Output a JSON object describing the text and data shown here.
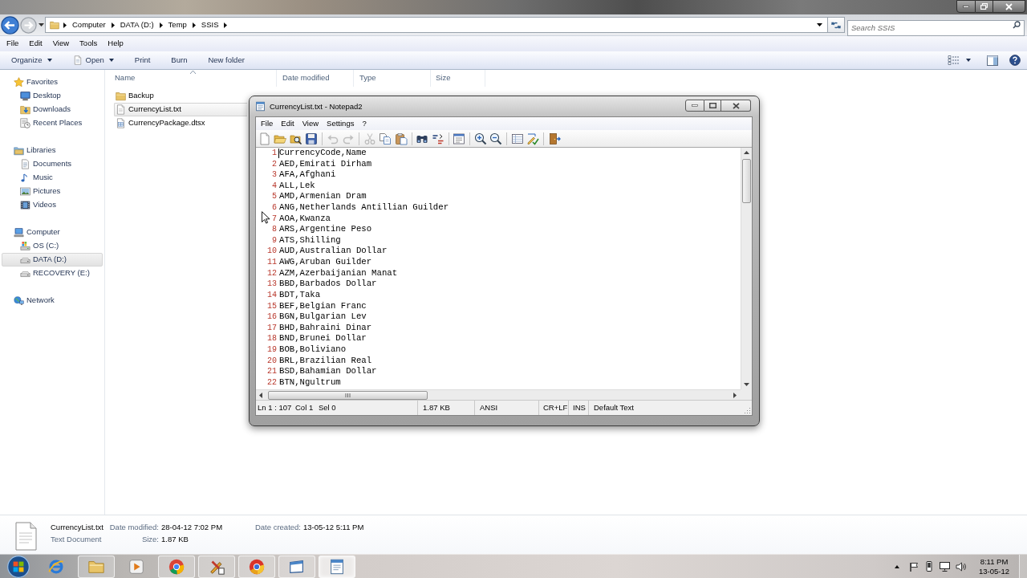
{
  "explorer": {
    "navigation": {
      "back": {
        "disabled": false
      },
      "forward": {
        "disabled": true
      }
    },
    "address_bar": {
      "path": [
        "Computer",
        "DATA (D:)",
        "Temp",
        "SSIS"
      ]
    },
    "search": {
      "placeholder": "Search SSIS"
    },
    "menu": [
      "File",
      "Edit",
      "View",
      "Tools",
      "Help"
    ],
    "commands": [
      {
        "label": "Organize",
        "dropdown": true
      },
      {
        "label": "Open",
        "dropdown": true
      },
      {
        "label": "Print",
        "dropdown": false
      },
      {
        "label": "Burn",
        "dropdown": false
      },
      {
        "label": "New folder",
        "dropdown": false
      }
    ],
    "navigation_pane": [
      {
        "label": "Favorites",
        "selected": false,
        "children": [
          {
            "label": "Desktop",
            "selected": false
          },
          {
            "label": "Downloads",
            "selected": false
          },
          {
            "label": "Recent Places",
            "selected": false
          }
        ]
      },
      {
        "label": "Libraries",
        "selected": false,
        "children": [
          {
            "label": "Documents",
            "selected": false
          },
          {
            "label": "Music",
            "selected": false
          },
          {
            "label": "Pictures",
            "selected": false
          },
          {
            "label": "Videos",
            "selected": false
          }
        ]
      },
      {
        "label": "Computer",
        "selected": false,
        "children": [
          {
            "label": "OS (C:)",
            "selected": false
          },
          {
            "label": "DATA (D:)",
            "selected": true
          },
          {
            "label": "RECOVERY (E:)",
            "selected": false
          }
        ]
      },
      {
        "label": "Network",
        "selected": false
      }
    ],
    "columns": [
      {
        "label": "Name",
        "sorted": true
      },
      {
        "label": "Date modified",
        "sorted": false
      },
      {
        "label": "Type",
        "sorted": false
      },
      {
        "label": "Size",
        "sorted": false
      }
    ],
    "files": [
      {
        "name": "Backup",
        "selected": false
      },
      {
        "name": "CurrencyList.txt",
        "selected": true
      },
      {
        "name": "CurrencyPackage.dtsx",
        "selected": false
      }
    ],
    "details": {
      "name": "CurrencyList.txt",
      "type": "Text Document",
      "properties": [
        {
          "label": "Date modified:",
          "value": "28-04-12 7:02 PM"
        },
        {
          "label": "Size:",
          "value": "1.87 KB"
        },
        {
          "label": "Date created:",
          "value": "13-05-12 5:11 PM"
        }
      ]
    }
  },
  "notepad": {
    "title": "CurrencyList.txt - Notepad2",
    "menu": [
      "File",
      "Edit",
      "View",
      "Settings",
      "?"
    ],
    "toolbar": [
      [
        {
          "disabled": false
        },
        {
          "disabled": false
        },
        {
          "disabled": false
        },
        {
          "disabled": false
        }
      ],
      [
        {
          "disabled": true
        },
        {
          "disabled": true
        }
      ],
      [
        {
          "disabled": true
        },
        {
          "disabled": false
        },
        {
          "disabled": false
        }
      ],
      [
        {
          "disabled": false
        },
        {
          "disabled": false
        }
      ],
      [
        {
          "disabled": false
        }
      ],
      [
        {
          "disabled": false
        },
        {
          "disabled": false
        }
      ],
      [
        {
          "disabled": false
        },
        {
          "disabled": false
        }
      ],
      [
        {
          "disabled": false
        }
      ]
    ],
    "lines": [
      {
        "number": "1",
        "text": "CurrencyCode,Name"
      },
      {
        "number": "2",
        "text": "AED,Emirati Dirham"
      },
      {
        "number": "3",
        "text": "AFA,Afghani"
      },
      {
        "number": "4",
        "text": "ALL,Lek"
      },
      {
        "number": "5",
        "text": "AMD,Armenian Dram"
      },
      {
        "number": "6",
        "text": "ANG,Netherlands Antillian Guilder"
      },
      {
        "number": "7",
        "text": "AOA,Kwanza"
      },
      {
        "number": "8",
        "text": "ARS,Argentine Peso"
      },
      {
        "number": "9",
        "text": "ATS,Shilling"
      },
      {
        "number": "10",
        "text": "AUD,Australian Dollar"
      },
      {
        "number": "11",
        "text": "AWG,Aruban Guilder"
      },
      {
        "number": "12",
        "text": "AZM,Azerbaijanian Manat"
      },
      {
        "number": "13",
        "text": "BBD,Barbados Dollar"
      },
      {
        "number": "14",
        "text": "BDT,Taka"
      },
      {
        "number": "15",
        "text": "BEF,Belgian Franc"
      },
      {
        "number": "16",
        "text": "BGN,Bulgarian Lev"
      },
      {
        "number": "17",
        "text": "BHD,Bahraini Dinar"
      },
      {
        "number": "18",
        "text": "BND,Brunei Dollar"
      },
      {
        "number": "19",
        "text": "BOB,Boliviano"
      },
      {
        "number": "20",
        "text": "BRL,Brazilian Real"
      },
      {
        "number": "21",
        "text": "BSD,Bahamian Dollar"
      },
      {
        "number": "22",
        "text": "BTN,Ngultrum"
      }
    ],
    "status_bar": [
      "Ln 1 : 107",
      "Col 1",
      "Sel 0",
      "1.87 KB",
      "ANSI",
      "CR+LF",
      "INS",
      "Default Text"
    ]
  },
  "taskbar": {
    "apps": [
      {
        "running": false,
        "selected": false
      },
      {
        "running": true,
        "selected": false
      },
      {
        "running": false,
        "selected": false
      },
      {
        "running": true,
        "selected": false
      },
      {
        "running": true,
        "selected": false
      },
      {
        "running": true,
        "selected": false
      },
      {
        "running": true,
        "selected": false
      },
      {
        "running": true,
        "selected": true
      }
    ],
    "clock": {
      "time": "8:11 PM",
      "date": "13-05-12"
    }
  }
}
